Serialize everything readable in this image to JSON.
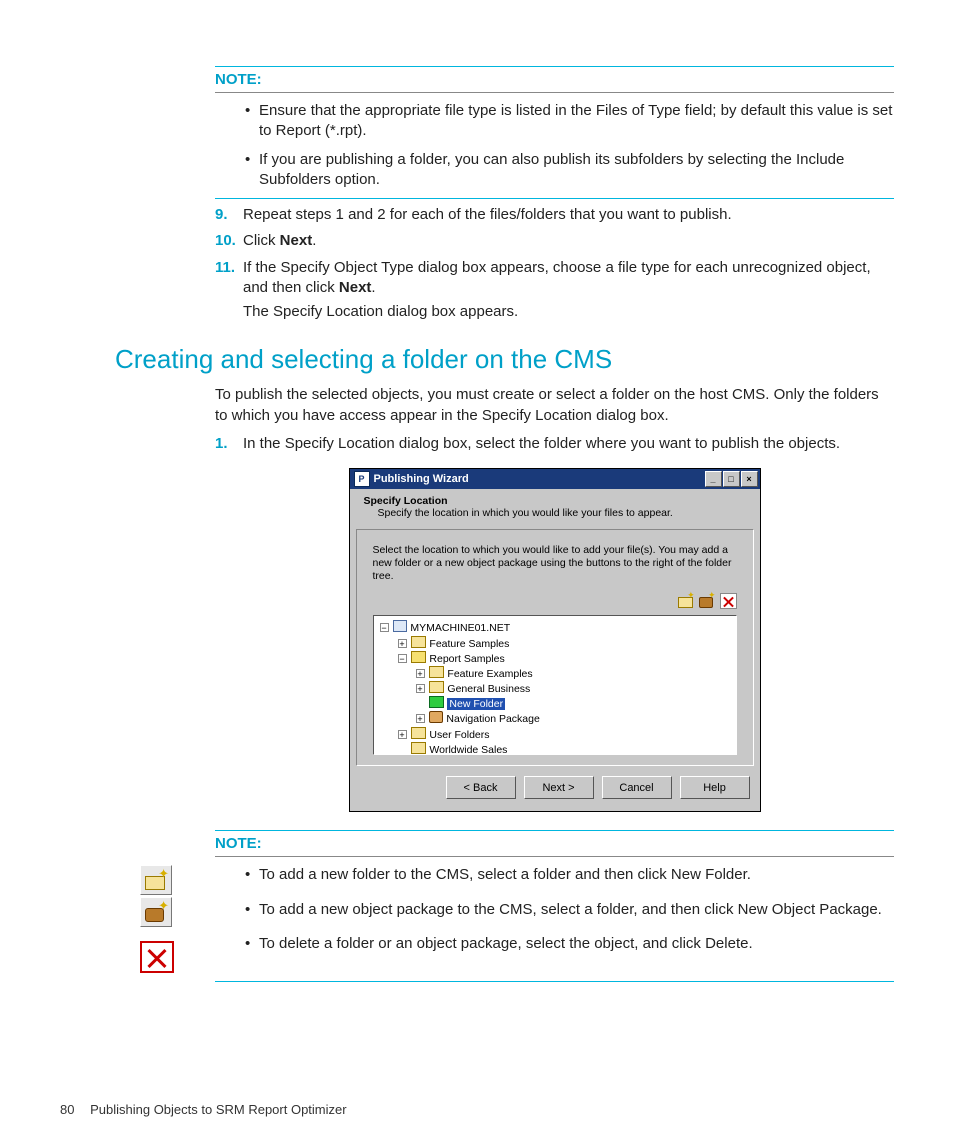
{
  "note_label": "NOTE:",
  "note1": {
    "items": [
      "Ensure that the appropriate file type is listed in the Files of Type field; by default this value is set to Report (*.rpt).",
      "If you are publishing a folder, you can also publish its subfolders by selecting the Include Subfolders option."
    ]
  },
  "steps_top": {
    "s9": {
      "num": "9.",
      "text": "Repeat steps 1 and 2 for each of the files/folders that you want to publish."
    },
    "s10": {
      "num": "10.",
      "pre": "Click ",
      "bold": "Next",
      "post": "."
    },
    "s11": {
      "num": "11.",
      "pre": "If the Specify Object Type dialog box appears, choose a file type for each unrecognized object, and then click ",
      "bold": "Next",
      "post": "."
    },
    "s11b": "The Specify Location dialog box appears."
  },
  "section_heading": "Creating and selecting a folder on the CMS",
  "section_intro": "To publish the selected objects, you must create or select a folder on the host CMS. Only the folders to which you have access appear in the Specify Location dialog box.",
  "step1": {
    "num": "1.",
    "text": "In the Specify Location dialog box, select the folder where you want to publish the objects."
  },
  "dialog": {
    "title": "Publishing Wizard",
    "head1": "Specify Location",
    "head2": "Specify the location in which you would like your files to appear.",
    "instr": "Select the location to which you would like to add your file(s). You may add a new folder or a new object package using the buttons to the right of the folder tree.",
    "tree": {
      "root": "MYMACHINE01.NET",
      "n1": "Feature Samples",
      "n2": "Report Samples",
      "n2a": "Feature Examples",
      "n2b": "General Business",
      "n2c": "New Folder",
      "n2d": "Navigation Package",
      "n3": "User Folders",
      "n4": "Worldwide Sales"
    },
    "buttons": {
      "back": "< Back",
      "next": "Next >",
      "cancel": "Cancel",
      "help": "Help"
    }
  },
  "note2": {
    "items": [
      "To add a new folder to the CMS, select a folder and then click New Folder.",
      "To add a new object package to the CMS, select a folder, and then click New Object Package.",
      "To delete a folder or an object package, select the object, and click Delete."
    ]
  },
  "footer": {
    "page": "80",
    "chapter": "Publishing Objects to SRM Report Optimizer"
  }
}
